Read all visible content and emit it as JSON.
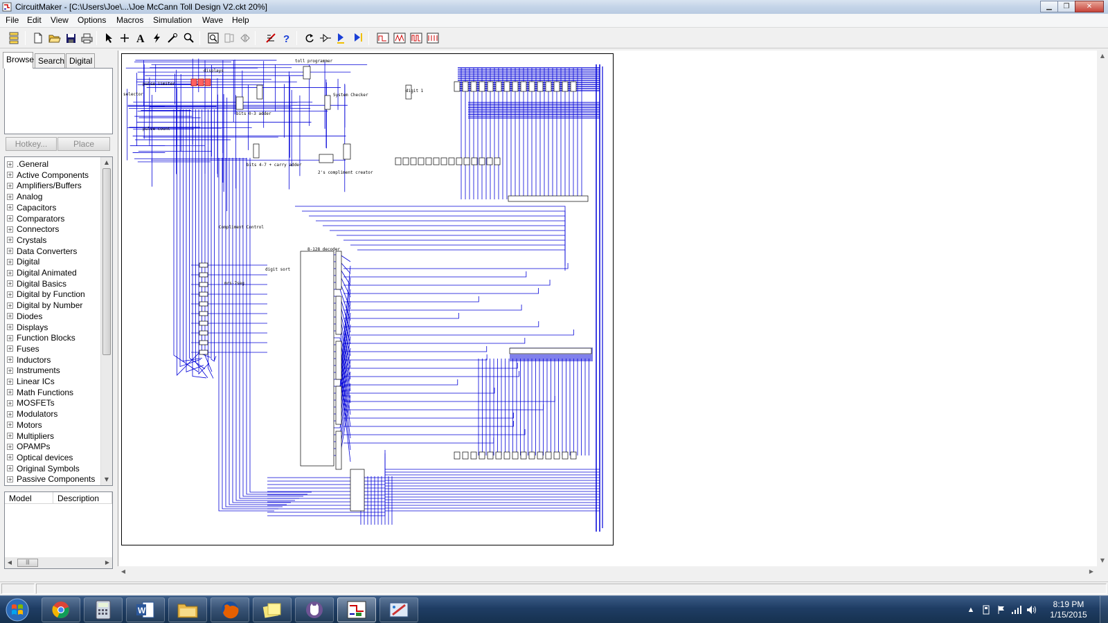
{
  "window": {
    "title": "CircuitMaker - [C:\\Users\\Joe\\...\\Joe McCann Toll Design V2.ckt 20%]",
    "controls": [
      "minimize",
      "restore",
      "close"
    ]
  },
  "menu": [
    "File",
    "Edit",
    "View",
    "Options",
    "Macros",
    "Simulation",
    "Wave",
    "Help"
  ],
  "toolbar": {
    "icons": [
      "panel-toggle-icon",
      "new-file-icon",
      "open-folder-icon",
      "save-disk-icon",
      "print-icon",
      "arrow-select-icon",
      "wire-cross-icon",
      "text-tool-icon",
      "probe-lightning-icon",
      "wand-icon",
      "zoom-magnifier-icon",
      "zoom-fit-icon",
      "mirror-icon",
      "flip-icon",
      "digital-sim-icon",
      "help-question-icon",
      "rotate-icon",
      "step-icon",
      "run-trace-icon",
      "run-step-icon",
      "waveform-a-icon",
      "waveform-b-icon",
      "waveform-c-icon",
      "waveform-d-icon"
    ]
  },
  "panel": {
    "tabs": [
      "Browse",
      "Search",
      "Digital"
    ],
    "active_tab": "Browse",
    "hotkey_button": "Hotkey...",
    "place_button": "Place",
    "tree_items": [
      ".General",
      "Active Components",
      "Amplifiers/Buffers",
      "Analog",
      "Capacitors",
      "Comparators",
      "Connectors",
      "Crystals",
      "Data Converters",
      "Digital",
      "Digital Animated",
      "Digital Basics",
      "Digital by Function",
      "Digital by Number",
      "Diodes",
      "Displays",
      "Function Blocks",
      "Fuses",
      "Inductors",
      "Instruments",
      "Linear ICs",
      "Math Functions",
      "MOSFETs",
      "Modulators",
      "Motors",
      "Multipliers",
      "OPAMPs",
      "Optical devices",
      "Original Symbols",
      "Passive Components"
    ],
    "grid_columns": [
      "Model",
      "Description"
    ]
  },
  "schematic": {
    "labels": [
      "displays",
      "toll programmer",
      "pulse limiter",
      "bits 0-3 adder",
      "System Checker",
      "digit 1",
      "bits 4-7 + carry adder",
      "2's compliment creator",
      "Compliment Control",
      "8-128 decoder",
      "digit sort",
      "mrs-7seg",
      "pulse count",
      "selector"
    ],
    "wire_color": "#0000d8"
  },
  "taskbar": {
    "apps": [
      "chrome-app-icon",
      "calculator-app-icon",
      "word-app-icon",
      "file-explorer-app-icon",
      "firefox-app-icon",
      "sticky-notes-app-icon",
      "github-app-icon",
      "circuitmaker-app-icon",
      "paint-app-icon"
    ],
    "active_app": "circuitmaker-app-icon",
    "time": "8:19 PM",
    "date": "1/15/2015"
  }
}
